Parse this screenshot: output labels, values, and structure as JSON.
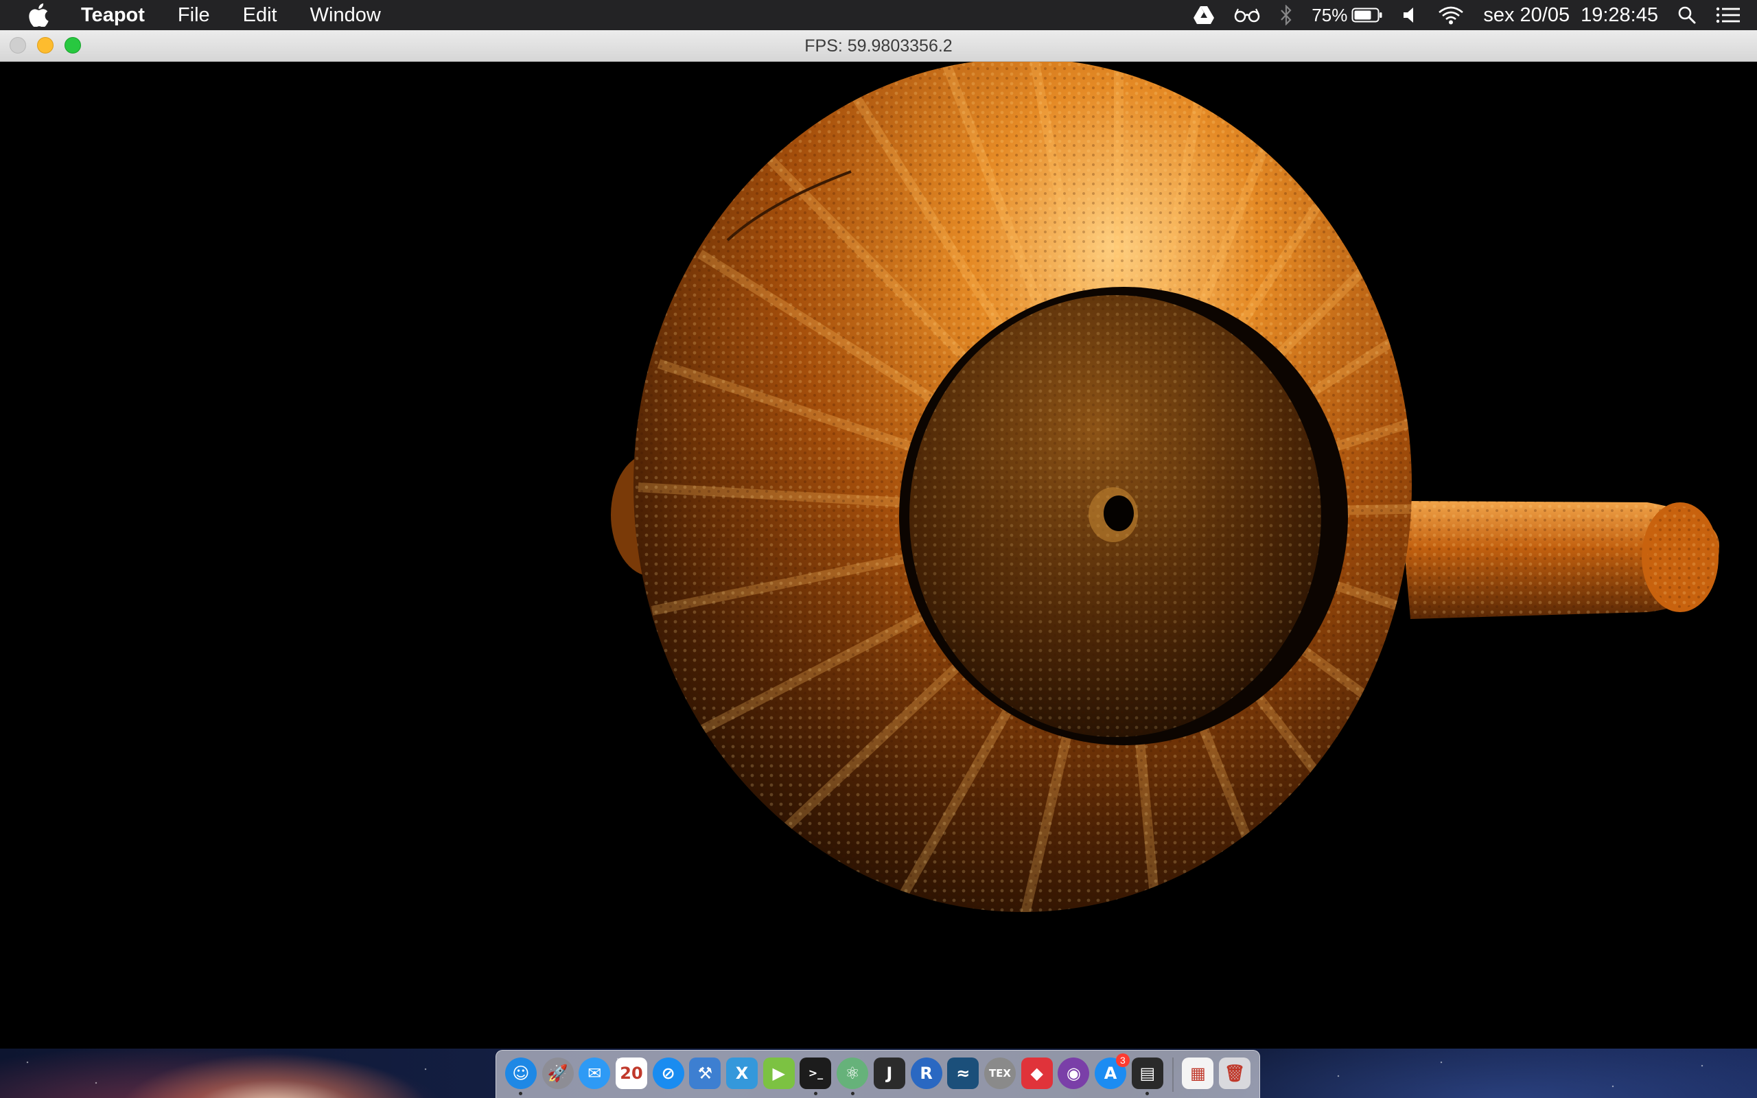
{
  "menubar": {
    "apple_icon": "apple-logo-icon",
    "app_name": "Teapot",
    "menus": [
      "File",
      "Edit",
      "Window"
    ],
    "status": {
      "drive_icon": "google-drive-icon",
      "reading_icon": "glasses-icon",
      "bluetooth_icon": "bluetooth-icon",
      "battery_percent": "75%",
      "battery_level": 0.75,
      "volume_icon": "speaker-icon",
      "wifi_icon": "wifi-icon",
      "date": "sex 20/05",
      "time": "19:28:45",
      "search_icon": "spotlight-icon",
      "notifications_icon": "notification-center-icon"
    }
  },
  "window": {
    "title": "FPS: 59.9803356.2",
    "traffic_lights": [
      "close",
      "minimize",
      "zoom"
    ],
    "content": "3d-rendered-textured-teapot"
  },
  "colors": {
    "menubar_bg": "#232325",
    "titlebar_bg": "#e3e3e3",
    "viewport_bg": "#000000",
    "teapot_orange": "#c8620e",
    "teapot_highlight": "#f3b257"
  },
  "dock": {
    "apps": [
      {
        "name": "Finder",
        "icon": "finder-icon",
        "glyph": "☺",
        "bg": "#1e88e5",
        "running": true
      },
      {
        "name": "Launchpad",
        "icon": "launchpad-icon",
        "glyph": "🚀",
        "bg": "#8d8d95",
        "running": false
      },
      {
        "name": "Airmail",
        "icon": "mail-icon",
        "glyph": "✉",
        "bg": "#2e9af5",
        "running": false
      },
      {
        "name": "Calendar",
        "icon": "calendar-icon",
        "glyph": "20",
        "bg": "#ffffff",
        "running": false
      },
      {
        "name": "Safari",
        "icon": "safari-compass-icon",
        "glyph": "⊘",
        "bg": "#1a8cf0",
        "running": false
      },
      {
        "name": "Xcode Instruments",
        "icon": "hammer-icon",
        "glyph": "⚒",
        "bg": "#3d7fd1",
        "running": false
      },
      {
        "name": "Xamarin",
        "icon": "xamarin-icon",
        "glyph": "X",
        "bg": "#3498db",
        "running": false
      },
      {
        "name": "Player",
        "icon": "play-icon",
        "glyph": "▶",
        "bg": "#7cc242",
        "running": false
      },
      {
        "name": "Terminal",
        "icon": "terminal-icon",
        "glyph": ">_",
        "bg": "#1c1c1c",
        "running": true
      },
      {
        "name": "Atom",
        "icon": "atom-icon",
        "glyph": "⚛",
        "bg": "#66b27a",
        "running": true
      },
      {
        "name": "IntelliJ",
        "icon": "intellij-icon",
        "glyph": "J",
        "bg": "#2b2b2b",
        "running": false
      },
      {
        "name": "R",
        "icon": "r-lang-icon",
        "glyph": "R",
        "bg": "#2a68c2",
        "running": false
      },
      {
        "name": "MySQL Workbench",
        "icon": "dolphin-icon",
        "glyph": "≈",
        "bg": "#1b4f7a",
        "running": false
      },
      {
        "name": "TeX",
        "icon": "tex-icon",
        "glyph": "TEX",
        "bg": "#8a8a8a",
        "running": false
      },
      {
        "name": "Git",
        "icon": "git-diamond-icon",
        "glyph": "◆",
        "bg": "#e0333a",
        "running": false
      },
      {
        "name": "GitHub",
        "icon": "github-octocat-icon",
        "glyph": "◉",
        "bg": "#7a3fa8",
        "running": false
      },
      {
        "name": "App Store",
        "icon": "app-store-icon",
        "glyph": "A",
        "bg": "#1c8cf2",
        "running": false,
        "badge": "3"
      },
      {
        "name": "Console",
        "icon": "console-icon",
        "glyph": "▤",
        "bg": "#2a2a2a",
        "running": true
      }
    ],
    "extras": [
      {
        "name": "Document",
        "icon": "document-file-icon",
        "glyph": "▦",
        "bg": "#f4f4f4"
      },
      {
        "name": "Trash",
        "icon": "trash-can-icon",
        "glyph": "🗑",
        "bg": "#d9d9dd"
      }
    ]
  }
}
